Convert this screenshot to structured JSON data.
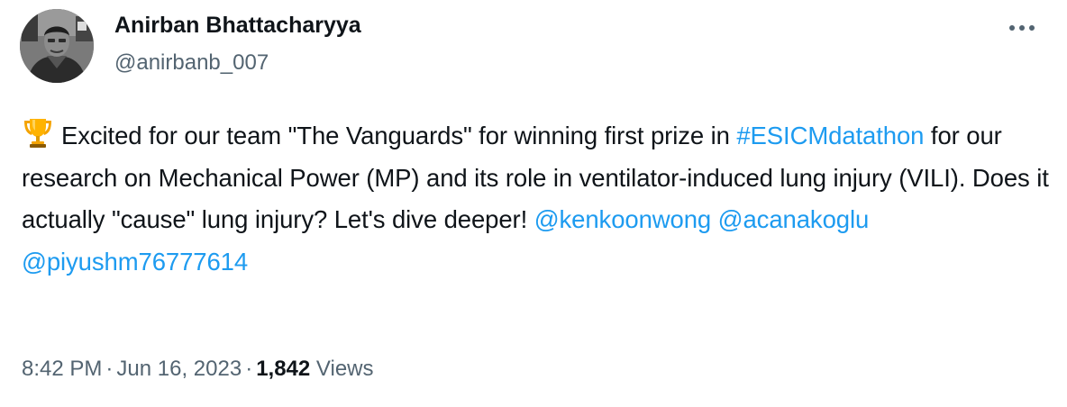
{
  "author": {
    "display_name": "Anirban Bhattacharyya",
    "handle": "@anirbanb_007"
  },
  "more_icon": "more-horizontal-icon",
  "tweet": {
    "emoji_icon": "trophy-icon",
    "text_part_1": "Excited for our team \"The Vanguards\" for winning first prize in ",
    "hashtag": "#ESICMdatathon",
    "text_part_2": " for our research on Mechanical Power (MP) and its role in ventilator-induced lung injury (VILI). Does it actually \"cause\" lung injury? Let's dive deeper! ",
    "mentions": [
      "@kenkoonwong",
      "@acanakoglu",
      "@piyushm76777614"
    ]
  },
  "meta": {
    "time": "8:42 PM",
    "separator": "·",
    "date": "Jun 16, 2023",
    "views_count": "1,842",
    "views_label": "Views"
  },
  "colors": {
    "link": "#1d9bf0",
    "text": "#0f1419",
    "secondary": "#536471"
  }
}
